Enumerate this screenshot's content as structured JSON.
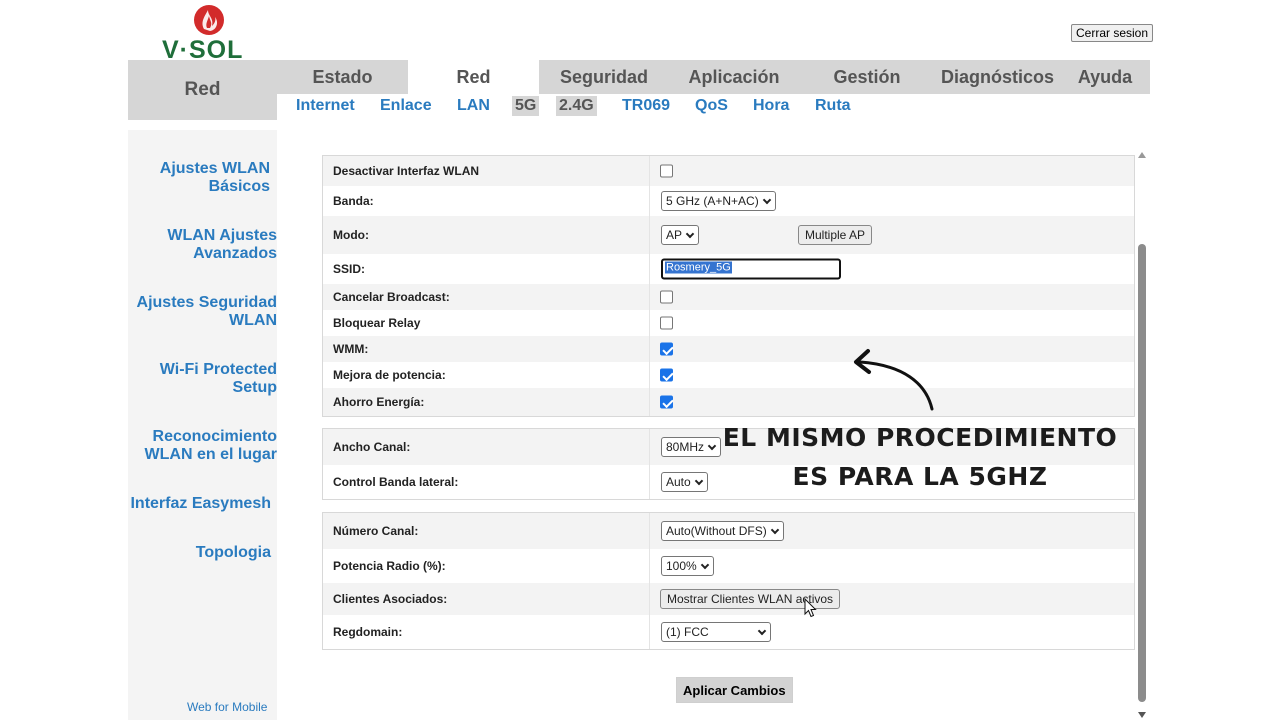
{
  "brand": {
    "logo_text": "V·SOL",
    "accent_color": "#d22b2b",
    "text_color": "#1f6e3a"
  },
  "header": {
    "logout_label": "Cerrar sesion"
  },
  "nav": {
    "section_label": "Red",
    "tabs": [
      {
        "label": "Estado"
      },
      {
        "label": "Red",
        "active": true
      },
      {
        "label": "Seguridad"
      },
      {
        "label": "Aplicación"
      },
      {
        "label": "Gestión"
      },
      {
        "label": "Diagnósticos"
      },
      {
        "label": "Ayuda"
      }
    ],
    "subtabs": [
      {
        "label": "Internet"
      },
      {
        "label": "Enlace"
      },
      {
        "label": "LAN"
      },
      {
        "label": "5G",
        "selected": true
      },
      {
        "label": "2.4G",
        "selected": true
      },
      {
        "label": "TR069"
      },
      {
        "label": "QoS"
      },
      {
        "label": "Hora"
      },
      {
        "label": "Ruta"
      }
    ]
  },
  "sidebar": {
    "items": [
      {
        "label_line1": "Ajustes WLAN",
        "label_line2": "Básicos"
      },
      {
        "label_line1": "WLAN Ajustes",
        "label_line2": "Avanzados"
      },
      {
        "label_line1": "Ajustes Seguridad",
        "label_line2": "WLAN"
      },
      {
        "label_line1": "Wi-Fi Protected",
        "label_line2": "Setup"
      },
      {
        "label_line1": "Reconocimiento",
        "label_line2": "WLAN en el lugar"
      },
      {
        "label_line1": "Interfaz Easymesh",
        "label_line2": ""
      },
      {
        "label_line1": "Topologia",
        "label_line2": ""
      }
    ],
    "web_mobile_label": "Web for Mobile"
  },
  "form": {
    "disable_wlan": {
      "label": "Desactivar Interfaz WLAN",
      "checked": false
    },
    "band": {
      "label": "Banda:",
      "value": "5 GHz (A+N+AC)"
    },
    "mode": {
      "label": "Modo:",
      "value": "AP",
      "multi_ap_label": "Multiple AP"
    },
    "ssid": {
      "label": "SSID:",
      "value": "Rosmery_5G"
    },
    "cancel_broadcast": {
      "label": "Cancelar Broadcast:",
      "checked": false
    },
    "block_relay": {
      "label": "Bloquear Relay",
      "checked": false
    },
    "wmm": {
      "label": "WMM:",
      "checked": true
    },
    "power_boost": {
      "label": "Mejora de potencia:",
      "checked": true
    },
    "energy_saving": {
      "label": "Ahorro Energía:",
      "checked": true
    },
    "channel_width": {
      "label": "Ancho Canal:",
      "value": "80MHz"
    },
    "sideband": {
      "label": "Control Banda lateral:",
      "value": "Auto"
    },
    "channel_number": {
      "label": "Número Canal:",
      "value": "Auto(Without DFS)"
    },
    "radio_power": {
      "label": "Potencia Radio (%):",
      "value": "100%"
    },
    "associated_clients": {
      "label": "Clientes Asociados:",
      "button_label": "Mostrar Clientes WLAN activos"
    },
    "regdomain": {
      "label": "Regdomain:",
      "value": "(1) FCC"
    },
    "apply_label": "Aplicar Cambios"
  },
  "overlay": {
    "line1": "EL MISMO PROCEDIMIENTO",
    "line2": "ES PARA LA 5GHZ"
  }
}
